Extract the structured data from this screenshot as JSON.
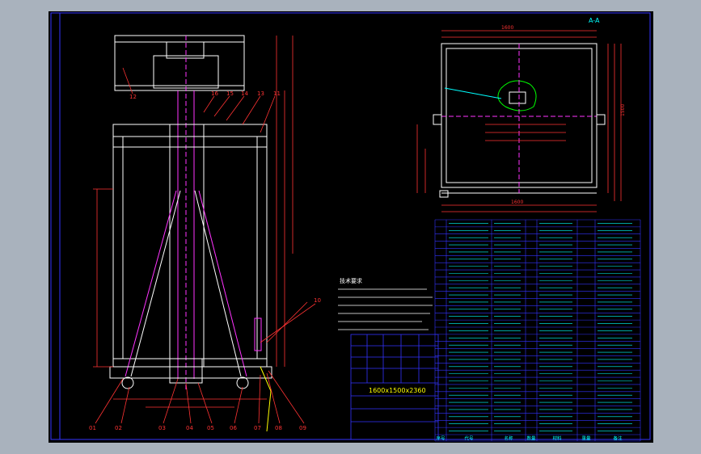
{
  "section_label": "A-A",
  "spec_text": "1600x1500x2360",
  "notes_heading": "技术要求",
  "part_numbers": [
    "01",
    "02",
    "03",
    "04",
    "05",
    "06",
    "07",
    "08",
    "09",
    "10",
    "11",
    "12",
    "13",
    "14",
    "15",
    "16"
  ],
  "dim_labels": {
    "top_width": "1600",
    "right_height": "1500",
    "bottom_width": "1600"
  },
  "bom_header": [
    "序号",
    "代号",
    "名称",
    "数量",
    "材料",
    "重量",
    "备注"
  ],
  "colors": {
    "outline": "#ffffff",
    "frame": "#0000cc",
    "dimension": "#ff3333",
    "centerline": "#ff33ff",
    "table_text": "#00ffff",
    "highlight": "#00ff00",
    "accent": "#ffff00"
  }
}
